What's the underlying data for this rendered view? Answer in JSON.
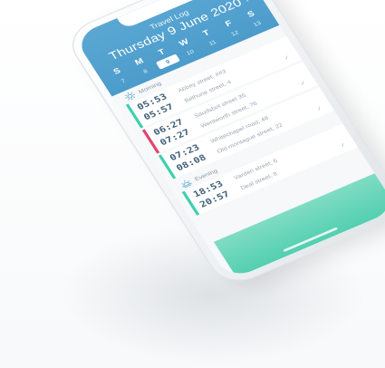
{
  "app": {
    "title": "Travel Log",
    "date": "Thursday 9 June 2020",
    "close_label": "×"
  },
  "week": [
    {
      "letter": "S",
      "num": "7"
    },
    {
      "letter": "M",
      "num": "8"
    },
    {
      "letter": "T",
      "num": "9",
      "selected": true
    },
    {
      "letter": "W",
      "num": "10"
    },
    {
      "letter": "T",
      "num": "11"
    },
    {
      "letter": "F",
      "num": "12"
    },
    {
      "letter": "S",
      "num": "13"
    }
  ],
  "sections": {
    "morning": {
      "label": "Morning",
      "icon": "sun-icon"
    },
    "evening": {
      "label": "Evening",
      "icon": "sunset-icon"
    }
  },
  "entries": [
    {
      "start": "05:53",
      "end": "05:57",
      "place1": "Abbey street, ##3",
      "place2": "Bethune street, 4",
      "color": "#3fcfae"
    },
    {
      "start": "06:27",
      "end": "07:27",
      "place1": "Saudsbot street 35",
      "place2": "Wentworth street, 76",
      "color": "#e0456e"
    },
    {
      "start": "07:23",
      "end": "08:08",
      "place1": "Whitechapel road, 48",
      "place2": "Old montague street, 22",
      "color": "#3fcfae"
    },
    {
      "start": "18:53",
      "end": "20:57",
      "place1": "Varden street, 6",
      "place2": "Deal street, 8",
      "color": "#3fcfae"
    }
  ],
  "check_icon": "✓",
  "colors": {
    "header": "#4c9ccb",
    "accent_teal": "#3fcfae",
    "accent_pink": "#e0456e",
    "time_text": "#40607a"
  }
}
